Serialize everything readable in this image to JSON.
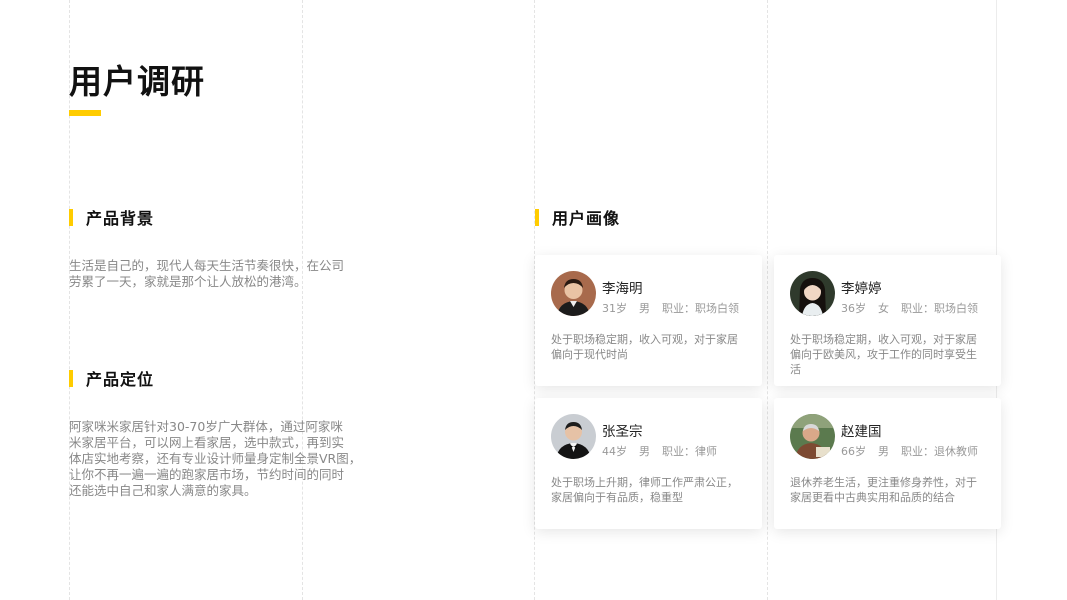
{
  "title": "用户调研",
  "colors": {
    "accent": "#FFCC00",
    "text": "#111111",
    "muted": "#888888"
  },
  "background": {
    "heading": "产品背景",
    "line1": "生活是自己的，现代人每天生活节奏很快，在公司",
    "line2": "劳累了一天，家就是那个让人放松的港湾。"
  },
  "positioning": {
    "heading": "产品定位",
    "line1": "阿家咪米家居针对30-70岁广大群体，通过阿家咪",
    "line2": "米家居平台，可以网上看家居，选中款式，再到实",
    "line3": "体店实地考察，还有专业设计师量身定制全景VR图，",
    "line4": "让你不再一遍一遍的跑家居市场，节约时间的同时",
    "line5": "还能选中自己和家人满意的家具。"
  },
  "personas": {
    "heading": "用户画像",
    "items": [
      {
        "name": "李海明",
        "age": "31岁",
        "gender": "男",
        "job": "职业：职场白领",
        "desc1": "处于职场稳定期，收入可观，对于家居",
        "desc2": "偏向于现代时尚",
        "desc3": "",
        "avatar": "young-man-avatar-icon"
      },
      {
        "name": "李婷婷",
        "age": "36岁",
        "gender": "女",
        "job": "职业：职场白领",
        "desc1": "处于职场稳定期，收入可观，对于家居",
        "desc2": "偏向于欧美风，攻于工作的同时享受生",
        "desc3": "活",
        "avatar": "woman-avatar-icon"
      },
      {
        "name": "张圣宗",
        "age": "44岁",
        "gender": "男",
        "job": "职业：律师",
        "desc1": "处于职场上升期，律师工作严肃公正，",
        "desc2": "家居偏向于有品质，稳重型",
        "desc3": "",
        "avatar": "man-in-suit-avatar-icon"
      },
      {
        "name": "赵建国",
        "age": "66岁",
        "gender": "男",
        "job": "职业：退休教师",
        "desc1": "退休养老生活，更注重修身养性，对于",
        "desc2": "家居更看中古典实用和品质的结合",
        "desc3": "",
        "avatar": "elderly-man-avatar-icon"
      }
    ]
  }
}
